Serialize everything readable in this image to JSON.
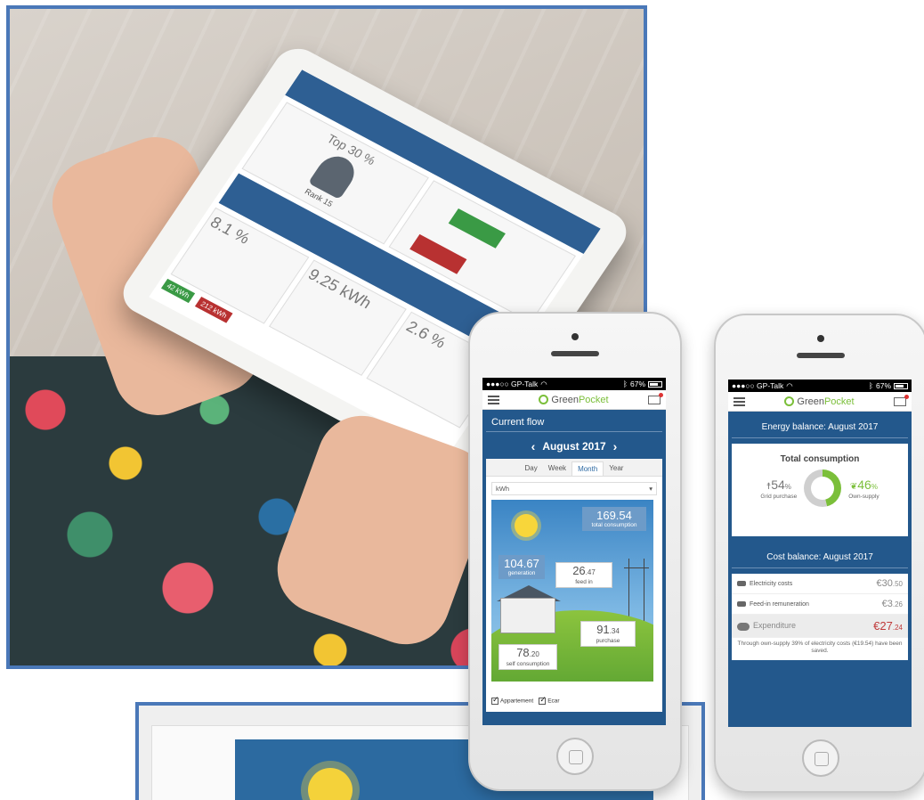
{
  "colors": {
    "frame_blue": "#4a78b8",
    "app_blue": "#23588c",
    "brand_green": "#7bbf3a",
    "expenditure_red": "#c03a3a"
  },
  "tablet": {
    "rank": "Rank 15",
    "top": "Top 30 %",
    "stat1": "8.1 %",
    "stat2": "9.25 kWh",
    "stat3": "2.6 %",
    "tag1": "42 kWh",
    "tag2": "212 kWh"
  },
  "phone1": {
    "status": {
      "carrier": "●●●○○ GP-Talk",
      "wifi": "wifi-icon",
      "bt": "ᛒ",
      "battery": "67%"
    },
    "brand": {
      "green": "Green",
      "pocket": "Pocket"
    },
    "section_title": "Current flow",
    "month": "August 2017",
    "tabs": [
      "Day",
      "Week",
      "Month",
      "Year"
    ],
    "unit": "kWh",
    "total": {
      "value": "169.54",
      "label": "total consumption"
    },
    "generation": {
      "value": "104.67",
      "label": "generation"
    },
    "feed_in": {
      "int": "26",
      "dec": ".47",
      "label": "feed in"
    },
    "purchase": {
      "int": "91",
      "dec": ".34",
      "label": "purchase"
    },
    "self_consumption": {
      "int": "78",
      "dec": ".20",
      "label": "self consumption"
    },
    "checks": [
      "Appartement",
      "Ecar"
    ]
  },
  "phone2": {
    "status": {
      "carrier": "●●●○○ GP-Talk",
      "bt": "ᛒ",
      "battery": "67%"
    },
    "brand": {
      "green": "Green",
      "pocket": "Pocket"
    },
    "energy_title": "Energy balance: August 2017",
    "total_title": "Total consumption",
    "grid": {
      "value": "54",
      "unit": "%",
      "label": "Grid purchase"
    },
    "own": {
      "value": "46",
      "unit": "%",
      "label": "Own-supply"
    },
    "own_supply_share": 0.46,
    "cost_title": "Cost balance: August 2017",
    "costs": [
      {
        "label": "Electricity costs",
        "int": "€30",
        "dec": ".50"
      },
      {
        "label": "Feed-in remuneration",
        "int": "€3",
        "dec": ".26"
      }
    ],
    "expenditure": {
      "label": "Expenditure",
      "int": "€27",
      "dec": ".24"
    },
    "note": "Through own-supply 39% of electricity costs (€19.54) have been saved."
  }
}
